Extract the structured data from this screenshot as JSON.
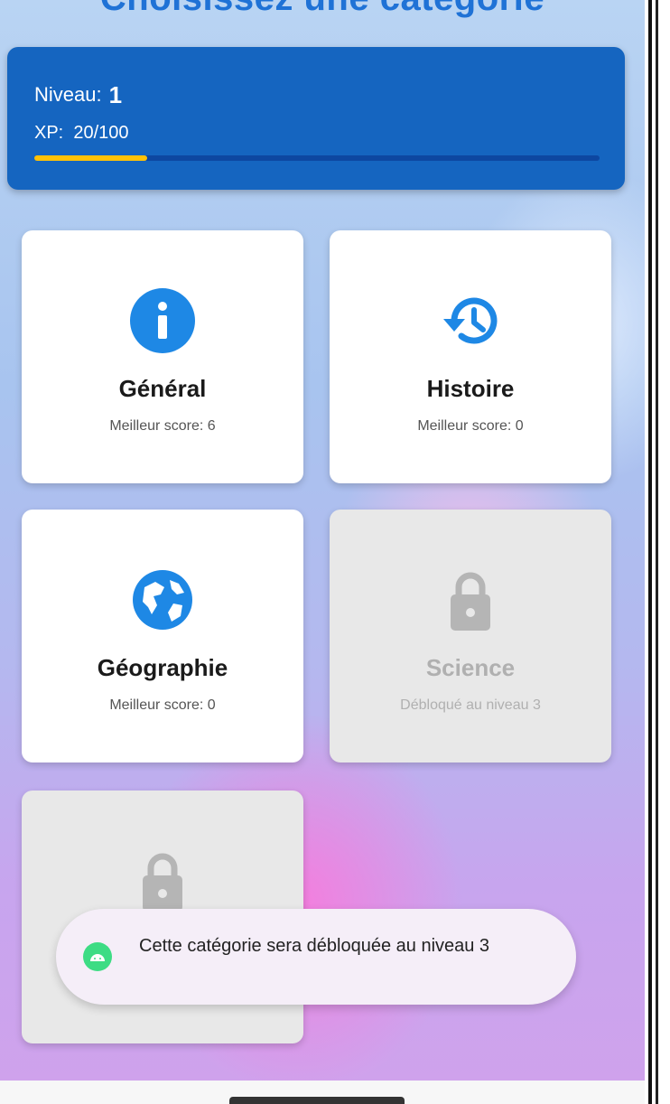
{
  "header": {
    "title": "Choisissez une catégorie"
  },
  "level": {
    "label": "Niveau:",
    "value": "1",
    "xp_label": "XP:",
    "xp_value": "20/100",
    "xp_progress": 0.2,
    "bar_color": "#ffc107",
    "card_color": "#1565c0"
  },
  "categories": [
    {
      "name": "Général",
      "subtitle": "Meilleur score: 6",
      "icon": "info-icon",
      "locked": false
    },
    {
      "name": "Histoire",
      "subtitle": "Meilleur score: 0",
      "icon": "history-icon",
      "locked": false
    },
    {
      "name": "Géographie",
      "subtitle": "Meilleur score: 0",
      "icon": "globe-icon",
      "locked": false
    },
    {
      "name": "Science",
      "subtitle": "Débloqué au niveau 3",
      "icon": "lock-icon",
      "locked": true
    },
    {
      "name": "",
      "subtitle": "",
      "icon": "lock-icon",
      "locked": true
    }
  ],
  "toast": {
    "message": "Cette catégorie sera débloquée au niveau 3",
    "icon": "android-icon"
  },
  "colors": {
    "accent": "#1e88e5",
    "locked_icon": "#b5b5b5"
  }
}
